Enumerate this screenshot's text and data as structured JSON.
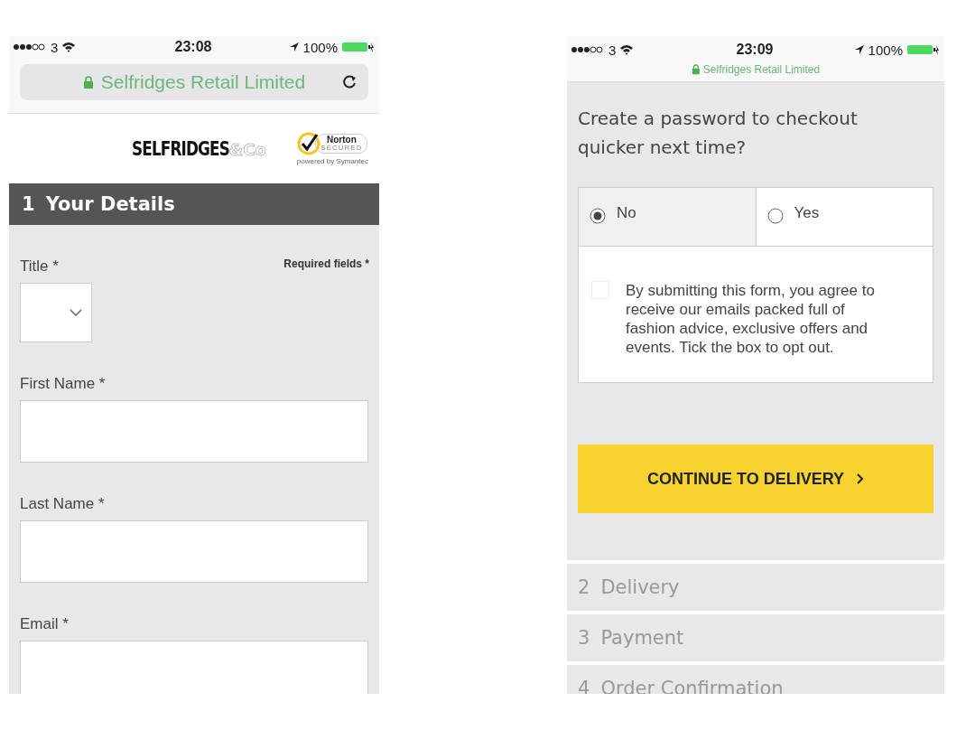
{
  "left_screen": {
    "status_bar": {
      "carrier": "3",
      "time": "23:08",
      "battery": "100%"
    },
    "address_bar": {
      "kind": "full",
      "text": "Selfridges Retail Limited"
    },
    "logo": {
      "brand": "SELFRIDGES",
      "brand_suffix": "&Co",
      "badge_name": "Norton",
      "badge_tagline": "SECURED",
      "badge_footer": "powered by Symantec"
    },
    "section": {
      "number": "1",
      "title": "Your Details"
    },
    "required_note": "Required fields *",
    "fields": [
      {
        "kind": "select",
        "label": "Title *"
      },
      {
        "kind": "text",
        "label": "First Name *"
      },
      {
        "kind": "text",
        "label": "Last Name *"
      },
      {
        "kind": "text",
        "label": "Email *"
      }
    ]
  },
  "right_screen": {
    "status_bar": {
      "carrier": "3",
      "time": "23:09",
      "battery": "100%"
    },
    "address_bar": {
      "kind": "compact",
      "text": "Selfridges Retail Limited"
    },
    "question": "Create a password to checkout quicker next time?",
    "options": [
      {
        "label": "No",
        "selected": true
      },
      {
        "label": "Yes",
        "selected": false
      }
    ],
    "consent": {
      "checked": false,
      "text": "By submitting this form, you agree to receive our emails packed full of fashion advice, exclusive offers and events. Tick the box to opt out."
    },
    "continue_button": "CONTINUE TO DELIVERY",
    "steps": [
      {
        "number": "2",
        "label": "Delivery"
      },
      {
        "number": "3",
        "label": "Payment"
      },
      {
        "number": "4",
        "label": "Order Confirmation"
      }
    ]
  }
}
